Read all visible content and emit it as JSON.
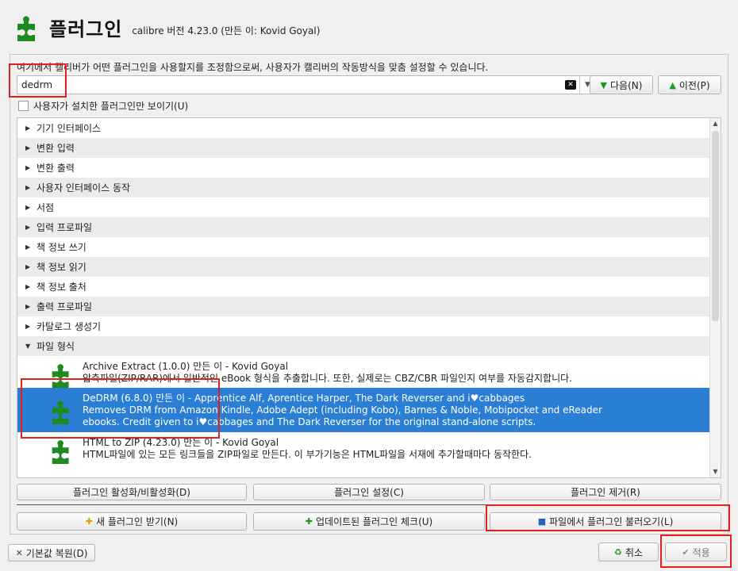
{
  "header": {
    "title": "플러그인",
    "subtitle": "calibre 버전 4.23.0 (만든 이: Kovid Goyal)"
  },
  "description": "여기에서 캘리버가 어떤 플러그인을 사용할지를 조정함으로써, 사용자가 캘리버의 작동방식을 맞춤 설정할 수 있습니다.",
  "search": {
    "value": "dedrm",
    "next_label": "다음(N)",
    "prev_label": "이전(P)"
  },
  "filter_checkbox": "사용자가 설치한 플러그인만 보이기(U)",
  "categories": [
    "기기 인터페이스",
    "변환 입력",
    "변환 출력",
    "사용자 인터페이스 동작",
    "서점",
    "입력 프로파일",
    "책 정보 쓰기",
    "책 정보 읽기",
    "책 정보 출처",
    "출력 프로파일",
    "카탈로그 생성기",
    "파일 형식"
  ],
  "plugins": [
    {
      "title": "Archive Extract (1.0.0) 만든 이 - Kovid Goyal",
      "desc": [
        "압축파일(ZIP/RAR)에서 일반적인 eBook 형식을 추출합니다. 또한, 실제로는 CBZ/CBR 파일인지 여부를 자동감지합니다."
      ]
    },
    {
      "title": "DeDRM (6.8.0) 만든 이 - Apprentice Alf, Aprentice Harper, The Dark Reverser and i♥cabbages",
      "desc": [
        "Removes DRM from Amazon Kindle, Adobe Adept (including Kobo), Barnes & Noble, Mobipocket and eReader",
        "ebooks. Credit given to i♥cabbages and The Dark Reverser for the original stand-alone scripts."
      ]
    },
    {
      "title": "HTML to ZIP (4.23.0) 만든 이 - Kovid Goyal",
      "desc": [
        "HTML파일에 있는 모든 링크들을 ZIP파일로 만든다. 이 부가기능은 HTML파일을 서재에 추가할때마다 동작한다."
      ]
    }
  ],
  "actions": {
    "toggle": "플러그인 활성화/비활성화(D)",
    "customize": "플러그인 설정(C)",
    "remove": "플러그인 제거(R)",
    "get_new": "새 플러그인 받기(N)",
    "check_updates": "업데이트된 플러그인 체크(U)",
    "load_from_file": "파일에서 플러그인 불러오기(L)"
  },
  "footer": {
    "restore": "기본값 복원(D)",
    "cancel": "취소",
    "apply": "적용"
  },
  "colors": {
    "selection": "#2a7fd4",
    "highlight": "#e32020",
    "plugin_icon": "#1f8a1f"
  }
}
